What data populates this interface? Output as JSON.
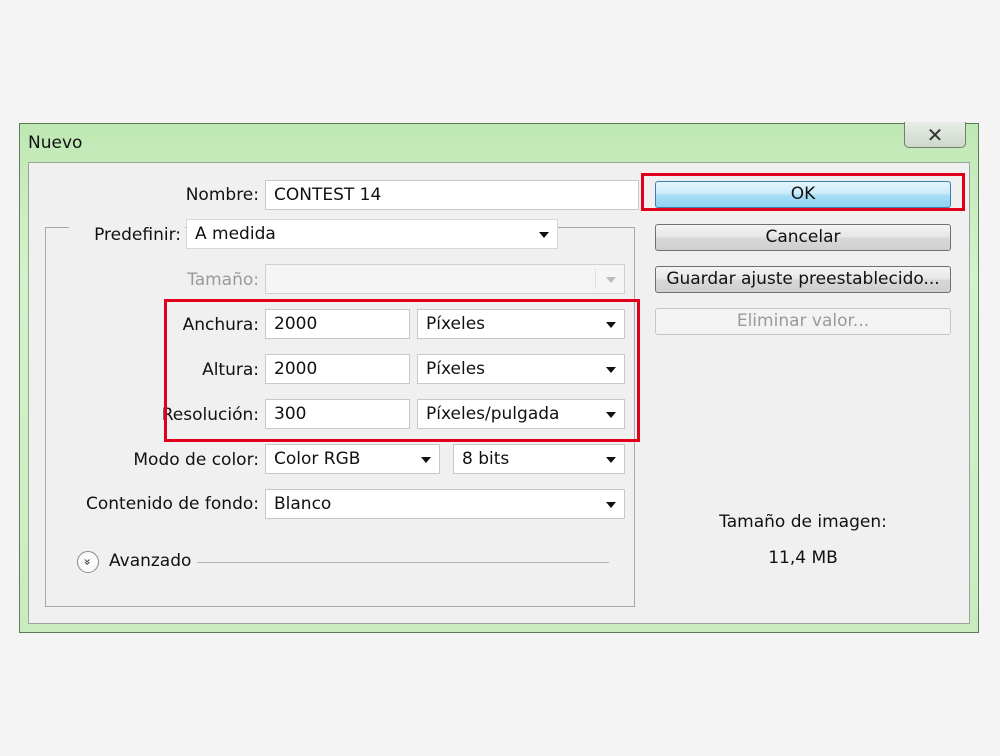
{
  "window": {
    "title": "Nuevo",
    "close_glyph": "✕"
  },
  "form": {
    "nombre": {
      "label": "Nombre:",
      "value": "CONTEST 14"
    },
    "predefinir": {
      "label": "Predefinir:",
      "value": "A medida"
    },
    "tamano": {
      "label": "Tamaño:",
      "value": ""
    },
    "anchura": {
      "label": "Anchura:",
      "value": "2000",
      "unit": "Píxeles"
    },
    "altura": {
      "label": "Altura:",
      "value": "2000",
      "unit": "Píxeles"
    },
    "resolucion": {
      "label": "Resolución:",
      "value": "300",
      "unit": "Píxeles/pulgada"
    },
    "modo_color": {
      "label": "Modo de color:",
      "value": "Color RGB",
      "bits": "8 bits"
    },
    "contenido_fondo": {
      "label": "Contenido de fondo:",
      "value": "Blanco"
    },
    "avanzado": {
      "label": "Avanzado",
      "icon_glyph": "»"
    }
  },
  "buttons": {
    "ok": "OK",
    "cancelar": "Cancelar",
    "guardar": "Guardar ajuste preestablecido...",
    "eliminar": "Eliminar valor..."
  },
  "info": {
    "label": "Tamaño de imagen:",
    "value": "11,4 MB"
  },
  "colors": {
    "highlight": "#e0001b",
    "titlebar": "#c8ecbf",
    "ok_button": "#a9def6"
  }
}
